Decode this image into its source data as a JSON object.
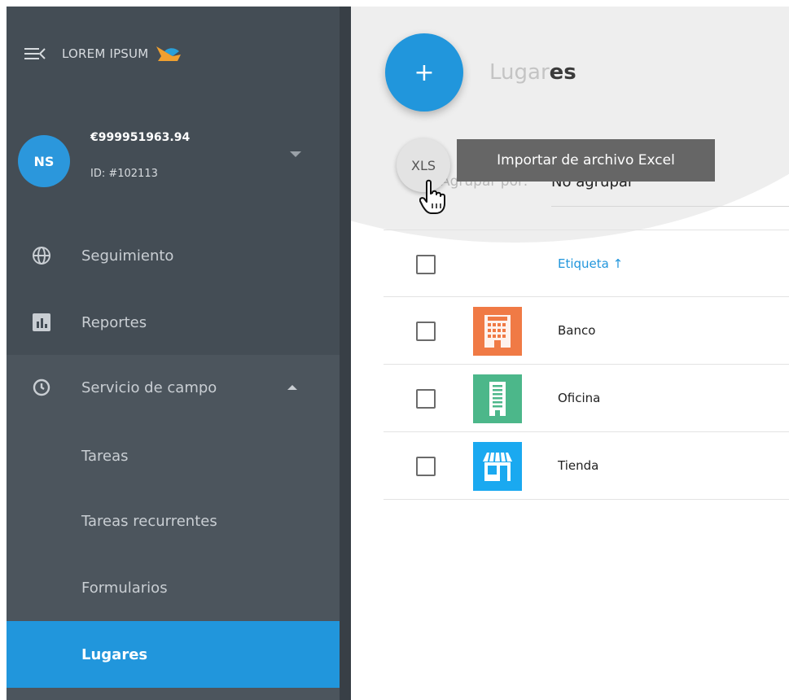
{
  "brand": {
    "name": "LOREM IPSUM"
  },
  "account": {
    "initials": "NS",
    "balance": "€999951963.94",
    "id": "ID: #102113"
  },
  "nav": {
    "tracking": "Seguimiento",
    "reports": "Reportes",
    "field_service": "Servicio de campo",
    "sub": {
      "tasks": "Tareas",
      "recurring": "Tareas recurrentes",
      "forms": "Formularios",
      "places": "Lugares"
    }
  },
  "main": {
    "add_label": "+",
    "title_faded": "Lugar",
    "title_end": "es",
    "xls_label": "XLS",
    "tooltip": "Importar de archivo Excel",
    "group_by_label": "Agrupar por:",
    "group_by_value": "No agrupar",
    "table": {
      "column_header": "Etiqueta",
      "sort_arrow": "↑",
      "rows": [
        {
          "label": "Banco",
          "icon": "bank-icon",
          "color": "#f07a45"
        },
        {
          "label": "Oficina",
          "icon": "office-building-icon",
          "color": "#4cb78a"
        },
        {
          "label": "Tienda",
          "icon": "store-icon",
          "color": "#1aa9f0"
        }
      ]
    }
  },
  "colors": {
    "sidebar": "#444d55",
    "accent": "#2196dc"
  }
}
